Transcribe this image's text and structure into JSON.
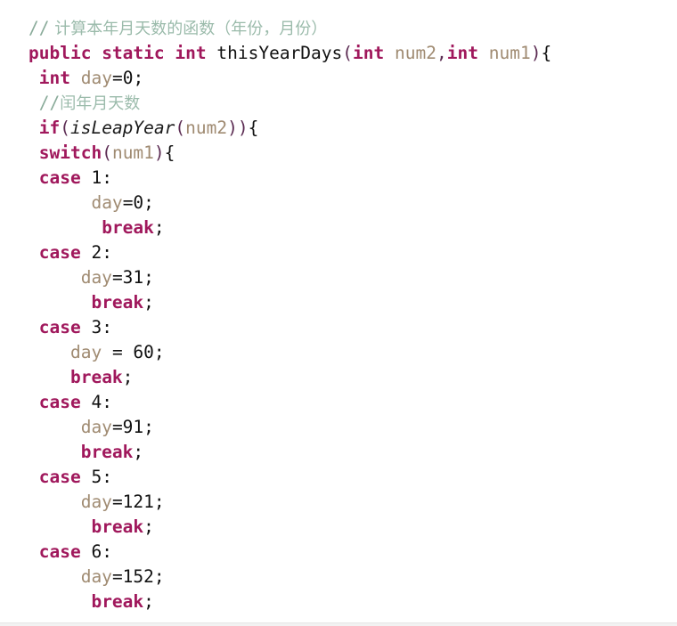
{
  "editor": {
    "language": "Java",
    "background_color": "#ffffff",
    "keyword_color": "#a0185c",
    "identifier_color": "#a08b72",
    "comment_color": "#8aab9a",
    "literal_color": "#111111",
    "punctuation_color": "#5b2b52"
  },
  "code": {
    "lines": [
      {
        "id": "line-1",
        "indent": "",
        "tokens": [
          {
            "t": "//",
            "k": "cmt"
          },
          {
            "t": " 计算本年月天数的函数（年份，月份）",
            "k": "cmt-cn"
          }
        ]
      },
      {
        "id": "line-2",
        "indent": "",
        "tokens": [
          {
            "t": "public",
            "k": "kw"
          },
          {
            "t": " ",
            "k": "plain"
          },
          {
            "t": "static",
            "k": "kw"
          },
          {
            "t": " ",
            "k": "plain"
          },
          {
            "t": "int",
            "k": "kw"
          },
          {
            "t": " ",
            "k": "plain"
          },
          {
            "t": "thisYearDays",
            "k": "plain"
          },
          {
            "t": "(",
            "k": "punct"
          },
          {
            "t": "int",
            "k": "kw"
          },
          {
            "t": " ",
            "k": "plain"
          },
          {
            "t": "num2",
            "k": "ident"
          },
          {
            "t": ",",
            "k": "punct"
          },
          {
            "t": "int",
            "k": "kw"
          },
          {
            "t": " ",
            "k": "plain"
          },
          {
            "t": "num1",
            "k": "ident"
          },
          {
            "t": ")",
            "k": "punct"
          },
          {
            "t": "{",
            "k": "plain"
          }
        ]
      },
      {
        "id": "line-3",
        "indent": " ",
        "tokens": [
          {
            "t": "int",
            "k": "kw"
          },
          {
            "t": " ",
            "k": "plain"
          },
          {
            "t": "day",
            "k": "ident"
          },
          {
            "t": "=0;",
            "k": "plain"
          }
        ]
      },
      {
        "id": "line-4",
        "indent": " ",
        "tokens": [
          {
            "t": "//",
            "k": "cmt"
          },
          {
            "t": "闰年月天数",
            "k": "cmt-cn"
          }
        ]
      },
      {
        "id": "line-5",
        "indent": " ",
        "tokens": [
          {
            "t": "if",
            "k": "kw"
          },
          {
            "t": "(",
            "k": "punct"
          },
          {
            "t": "isLeapYear",
            "k": "method"
          },
          {
            "t": "(",
            "k": "punct"
          },
          {
            "t": "num2",
            "k": "ident"
          },
          {
            "t": "))",
            "k": "punct"
          },
          {
            "t": "{",
            "k": "plain"
          }
        ]
      },
      {
        "id": "line-6",
        "indent": " ",
        "tokens": [
          {
            "t": "switch",
            "k": "kw"
          },
          {
            "t": "(",
            "k": "punct"
          },
          {
            "t": "num1",
            "k": "ident"
          },
          {
            "t": ")",
            "k": "punct"
          },
          {
            "t": "{",
            "k": "plain"
          }
        ]
      },
      {
        "id": "line-7",
        "indent": " ",
        "tokens": [
          {
            "t": "case",
            "k": "kw"
          },
          {
            "t": " ",
            "k": "plain"
          },
          {
            "t": "1",
            "k": "num"
          },
          {
            "t": ":",
            "k": "plain"
          }
        ]
      },
      {
        "id": "line-8",
        "indent": "      ",
        "tokens": [
          {
            "t": "day",
            "k": "ident"
          },
          {
            "t": "=0;",
            "k": "plain"
          }
        ]
      },
      {
        "id": "line-9",
        "indent": "       ",
        "tokens": [
          {
            "t": "break",
            "k": "kw"
          },
          {
            "t": ";",
            "k": "plain"
          }
        ]
      },
      {
        "id": "line-10",
        "indent": " ",
        "tokens": [
          {
            "t": "case",
            "k": "kw"
          },
          {
            "t": " ",
            "k": "plain"
          },
          {
            "t": "2",
            "k": "num"
          },
          {
            "t": ":",
            "k": "plain"
          }
        ]
      },
      {
        "id": "line-11",
        "indent": "     ",
        "tokens": [
          {
            "t": "day",
            "k": "ident"
          },
          {
            "t": "=31;",
            "k": "plain"
          }
        ]
      },
      {
        "id": "line-12",
        "indent": "      ",
        "tokens": [
          {
            "t": "break",
            "k": "kw"
          },
          {
            "t": ";",
            "k": "plain"
          }
        ]
      },
      {
        "id": "line-13",
        "indent": " ",
        "tokens": [
          {
            "t": "case",
            "k": "kw"
          },
          {
            "t": " ",
            "k": "plain"
          },
          {
            "t": "3",
            "k": "num"
          },
          {
            "t": ":",
            "k": "plain"
          }
        ]
      },
      {
        "id": "line-14",
        "indent": "    ",
        "tokens": [
          {
            "t": "day",
            "k": "ident"
          },
          {
            "t": " = 60;",
            "k": "plain"
          }
        ]
      },
      {
        "id": "line-15",
        "indent": "    ",
        "tokens": [
          {
            "t": "break",
            "k": "kw"
          },
          {
            "t": ";",
            "k": "plain"
          }
        ]
      },
      {
        "id": "line-16",
        "indent": " ",
        "tokens": [
          {
            "t": "case",
            "k": "kw"
          },
          {
            "t": " ",
            "k": "plain"
          },
          {
            "t": "4",
            "k": "num"
          },
          {
            "t": ":",
            "k": "plain"
          }
        ]
      },
      {
        "id": "line-17",
        "indent": "     ",
        "tokens": [
          {
            "t": "day",
            "k": "ident"
          },
          {
            "t": "=91;",
            "k": "plain"
          }
        ]
      },
      {
        "id": "line-18",
        "indent": "     ",
        "tokens": [
          {
            "t": "break",
            "k": "kw"
          },
          {
            "t": ";",
            "k": "plain"
          }
        ]
      },
      {
        "id": "line-19",
        "indent": " ",
        "tokens": [
          {
            "t": "case",
            "k": "kw"
          },
          {
            "t": " ",
            "k": "plain"
          },
          {
            "t": "5",
            "k": "num"
          },
          {
            "t": ":",
            "k": "plain"
          }
        ]
      },
      {
        "id": "line-20",
        "indent": "     ",
        "tokens": [
          {
            "t": "day",
            "k": "ident"
          },
          {
            "t": "=121;",
            "k": "plain"
          }
        ]
      },
      {
        "id": "line-21",
        "indent": "      ",
        "tokens": [
          {
            "t": "break",
            "k": "kw"
          },
          {
            "t": ";",
            "k": "plain"
          }
        ]
      },
      {
        "id": "line-22",
        "indent": " ",
        "tokens": [
          {
            "t": "case",
            "k": "kw"
          },
          {
            "t": " ",
            "k": "plain"
          },
          {
            "t": "6",
            "k": "num"
          },
          {
            "t": ":",
            "k": "plain"
          }
        ]
      },
      {
        "id": "line-23",
        "indent": "     ",
        "tokens": [
          {
            "t": "day",
            "k": "ident"
          },
          {
            "t": "=152;",
            "k": "plain"
          }
        ]
      },
      {
        "id": "line-24",
        "indent": "      ",
        "tokens": [
          {
            "t": "break",
            "k": "kw"
          },
          {
            "t": ";",
            "k": "plain"
          }
        ]
      }
    ]
  }
}
